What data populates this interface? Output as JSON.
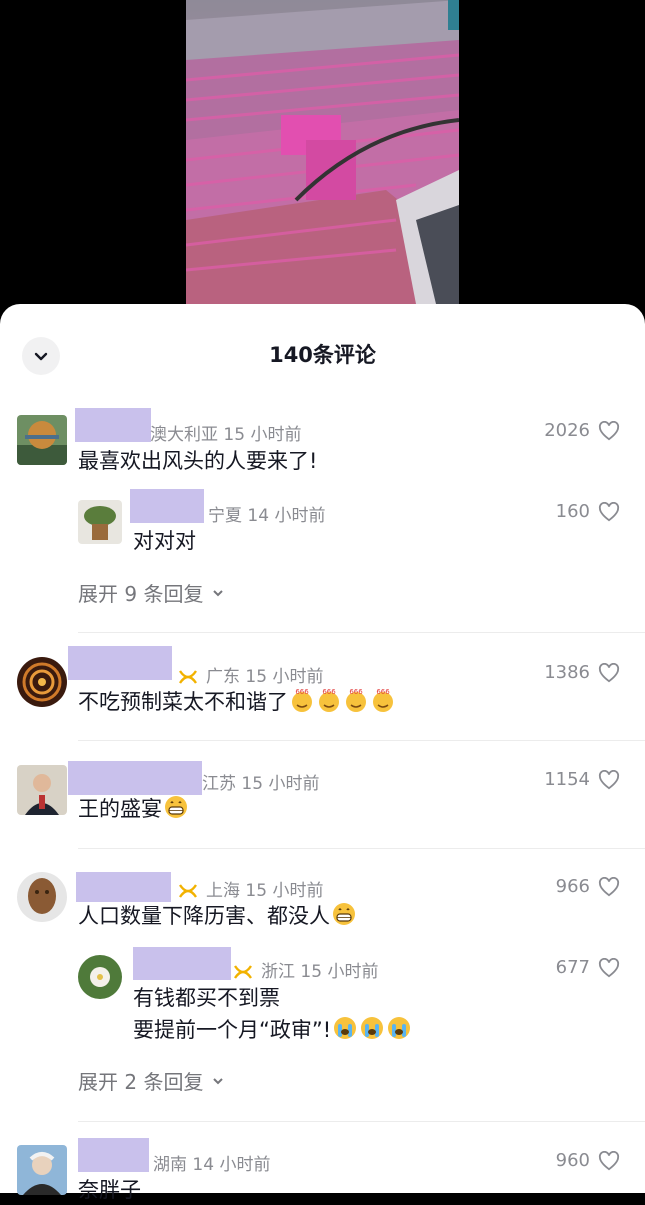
{
  "sheet": {
    "title": "140条评论"
  },
  "comments": [
    {
      "location": "澳大利亚",
      "time": "15 小时前",
      "text": "最喜欢出风头的人要来了!",
      "likes": "2026"
    },
    {
      "location": "宁夏",
      "time": "14 小时前",
      "text": "对对对",
      "likes": "160"
    },
    {
      "expand": "展开 9 条回复"
    },
    {
      "location": "广东",
      "time": "15 小时前",
      "text": "不吃预制菜太不和谐了",
      "likes": "1386",
      "emoji": "666-emoji"
    },
    {
      "location": "江苏",
      "time": "15 小时前",
      "text": "王的盛宴",
      "likes": "1154",
      "emoji": "grin-emoji"
    },
    {
      "location": "上海",
      "time": "15 小时前",
      "text": "人口数量下降历害、都没人",
      "likes": "966",
      "emoji": "grin-emoji"
    },
    {
      "location": "浙江",
      "time": "15 小时前",
      "line1": "有钱都买不到票",
      "line2": "要提前一个月“政审”!",
      "likes": "677",
      "emoji": "crying-emoji"
    },
    {
      "expand": "展开 2 条回复"
    },
    {
      "location": "湖南",
      "time": "14 小时前",
      "text": "奈胖子",
      "likes": "960"
    }
  ],
  "colors": {
    "name_redaction": "#c9c1ec",
    "meta": "#8a8b91",
    "badge": "#f2b200"
  }
}
